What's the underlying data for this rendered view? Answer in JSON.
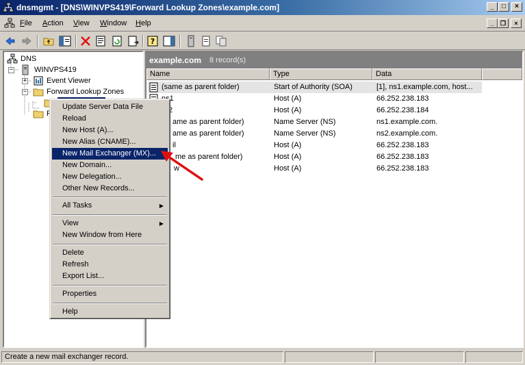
{
  "window": {
    "title": "dnsmgmt - [DNS\\WINVPS419\\Forward Lookup Zones\\example.com]",
    "controls": [
      "_",
      "□",
      "×"
    ]
  },
  "menubar": [
    {
      "label": "File",
      "u": "F",
      "rest": "ile"
    },
    {
      "label": "Action",
      "u": "A",
      "rest": "ction"
    },
    {
      "label": "View",
      "u": "V",
      "rest": "iew"
    },
    {
      "label": "Window",
      "u": "W",
      "rest": "indow"
    },
    {
      "label": "Help",
      "u": "H",
      "rest": "elp"
    }
  ],
  "mdi_controls": [
    "_",
    "❐",
    "×"
  ],
  "tree": {
    "root": "DNS",
    "server": "WINVPS419",
    "event_viewer": "Event Viewer",
    "forward_zones": "Forward Lookup Zones",
    "partial_label": "F"
  },
  "zone_header": {
    "name": "example.com",
    "count": "8 record(s)"
  },
  "columns": [
    "Name",
    "Type",
    "Data"
  ],
  "records": [
    {
      "name": "(same as parent folder)",
      "type": "Start of Authority (SOA)",
      "data": "[1], ns1.example.com, host..."
    },
    {
      "name": "ns1",
      "type": "Host (A)",
      "data": "66.252.238.183"
    },
    {
      "name": "ns2",
      "type": "Host (A)",
      "data": "66.252.238.184"
    },
    {
      "name": "(same as parent folder)",
      "type": "Name Server (NS)",
      "data": "ns1.example.com."
    },
    {
      "name": "(same as parent folder)",
      "type": "Name Server (NS)",
      "data": "ns2.example.com."
    },
    {
      "name": "mail",
      "type": "Host (A)",
      "data": "66.252.238.183"
    },
    {
      "name": "(same as parent folder)",
      "type": "Host (A)",
      "data": "66.252.238.183"
    },
    {
      "name": "www",
      "type": "Host (A)",
      "data": "66.252.238.183"
    }
  ],
  "visible_name_fragments": [
    "(same as parent folder)",
    "ns1",
    "2",
    "ame as parent folder)",
    "ame as parent folder)",
    "il",
    "me as parent folder)",
    "w"
  ],
  "context_menu": [
    {
      "label": "Update Server Data File"
    },
    {
      "label": "Reload"
    },
    {
      "label": "New Host (A)..."
    },
    {
      "label": "New Alias (CNAME)..."
    },
    {
      "label": "New Mail Exchanger (MX)...",
      "highlighted": true
    },
    {
      "label": "New Domain..."
    },
    {
      "label": "New Delegation..."
    },
    {
      "label": "Other New Records..."
    },
    {
      "separator": true
    },
    {
      "label": "All Tasks",
      "submenu": true
    },
    {
      "separator": true
    },
    {
      "label": "View",
      "submenu": true
    },
    {
      "label": "New Window from Here"
    },
    {
      "separator": true
    },
    {
      "label": "Delete"
    },
    {
      "label": "Refresh"
    },
    {
      "label": "Export List..."
    },
    {
      "separator": true
    },
    {
      "label": "Properties"
    },
    {
      "separator": true
    },
    {
      "label": "Help"
    }
  ],
  "status": {
    "text": "Create a new mail exchanger record."
  },
  "colors": {
    "title_start": "#0a246a",
    "title_end": "#a6caf0",
    "highlight": "#0a246a",
    "arrow": "#e01010",
    "chrome": "#d4d0c8"
  }
}
